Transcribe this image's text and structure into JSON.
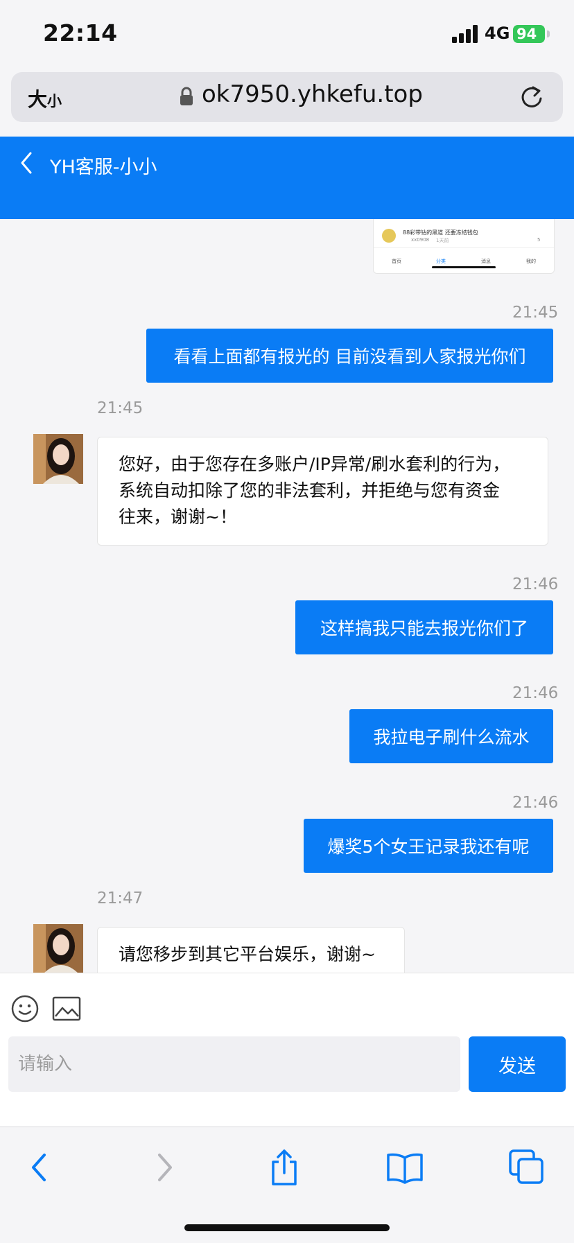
{
  "status_bar": {
    "time": "22:14",
    "network": "4G",
    "battery": "94"
  },
  "url_bar": {
    "text_size_big": "大",
    "text_size_small": "小",
    "url": "ok7950.yhkefu.top"
  },
  "header": {
    "title": "YH客服-小小"
  },
  "thumbnail": {
    "post_title": "88彩带钻的黑道 还要冻结钱包",
    "post_user": "xx0908",
    "post_time": "1天前",
    "comments": "5",
    "tabs": [
      "首页",
      "分类",
      "消息",
      "我的"
    ]
  },
  "messages": [
    {
      "side": "out",
      "time": "21:45",
      "text": "看看上面都有报光的 目前没看到人家报光你们"
    },
    {
      "side": "in",
      "time": "21:45",
      "lines": [
        "您好，由于您存在多账户/IP异常/刷水套利的行为，",
        "系统自动扣除了您的非法套利，并拒绝与您有资金",
        "往来，谢谢~！"
      ]
    },
    {
      "side": "out",
      "time": "21:46",
      "text": "这样搞我只能去报光你们了"
    },
    {
      "side": "out",
      "time": "21:46",
      "text": "我拉电子刷什么流水"
    },
    {
      "side": "out",
      "time": "21:46",
      "text": "爆奖5个女王记录我还有呢"
    },
    {
      "side": "in",
      "time": "21:47",
      "lines": [
        "请您移步到其它平台娱乐，谢谢~"
      ]
    }
  ],
  "input": {
    "placeholder": "请输入",
    "send_label": "发送"
  },
  "colors": {
    "primary": "#0a7cf5",
    "battery": "#34c759"
  },
  "icons": [
    "back-chevron-icon",
    "emoji-icon",
    "image-icon",
    "lock-icon",
    "reload-icon",
    "share-icon",
    "bookmarks-icon",
    "tabs-icon"
  ]
}
